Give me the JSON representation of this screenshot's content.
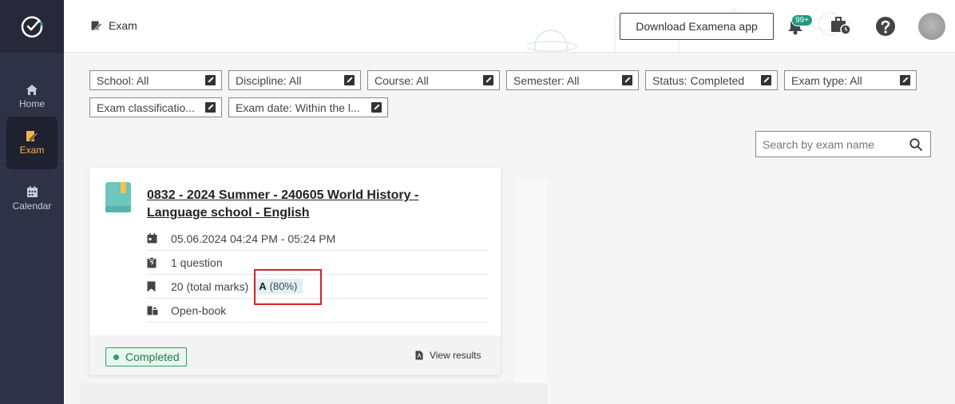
{
  "sidebar": {
    "items": [
      {
        "label": "Home",
        "icon": "home-icon",
        "active": false
      },
      {
        "label": "Exam",
        "icon": "exam-icon",
        "active": true
      },
      {
        "label": "Calendar",
        "icon": "calendar-icon",
        "active": false
      }
    ]
  },
  "header": {
    "title": "Exam",
    "download_label": "Download Examena app",
    "notification_count": "99+"
  },
  "filters": [
    {
      "label": "School: All"
    },
    {
      "label": "Discipline: All"
    },
    {
      "label": "Course: All"
    },
    {
      "label": "Semester: All"
    },
    {
      "label": "Status: Completed"
    },
    {
      "label": "Exam type: All"
    },
    {
      "label": "Exam classificatio..."
    },
    {
      "label": "Exam date: Within the l..."
    }
  ],
  "search": {
    "placeholder": "Search by exam name"
  },
  "exam_card": {
    "title": "0832 - 2024 Summer - 240605 World History - Language school - English",
    "datetime": "05.06.2024 04:24 PM - 05:24 PM",
    "questions": "1 question",
    "total_marks": "20 (total marks)",
    "grade_letter": "A",
    "grade_percent": "(80%)",
    "mode": "Open-book",
    "status": "Completed",
    "view_results_label": "View results"
  },
  "colors": {
    "sidebar": "#2f3146",
    "accent": "#f0b64a",
    "status": "#27a36b",
    "highlight": "#d2232a"
  }
}
